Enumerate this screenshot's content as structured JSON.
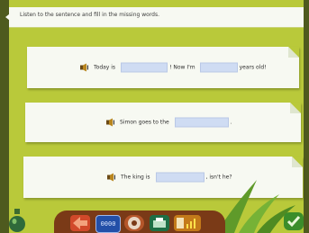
{
  "instruction": "Listen to the sentence and fill in the missing words.",
  "sentences": [
    {
      "parts": [
        "Today is",
        "! Now I'm",
        "years old!"
      ]
    },
    {
      "parts": [
        "Simon goes to the",
        "."
      ]
    },
    {
      "parts": [
        "The king is",
        ", isn't he?"
      ]
    }
  ],
  "toolbar": {
    "display_text": "0000"
  },
  "colors": {
    "background": "#b9c93a",
    "card": "#f7f9f2",
    "blank": "#cfdcf3",
    "toolbar": "#7a3a17"
  }
}
